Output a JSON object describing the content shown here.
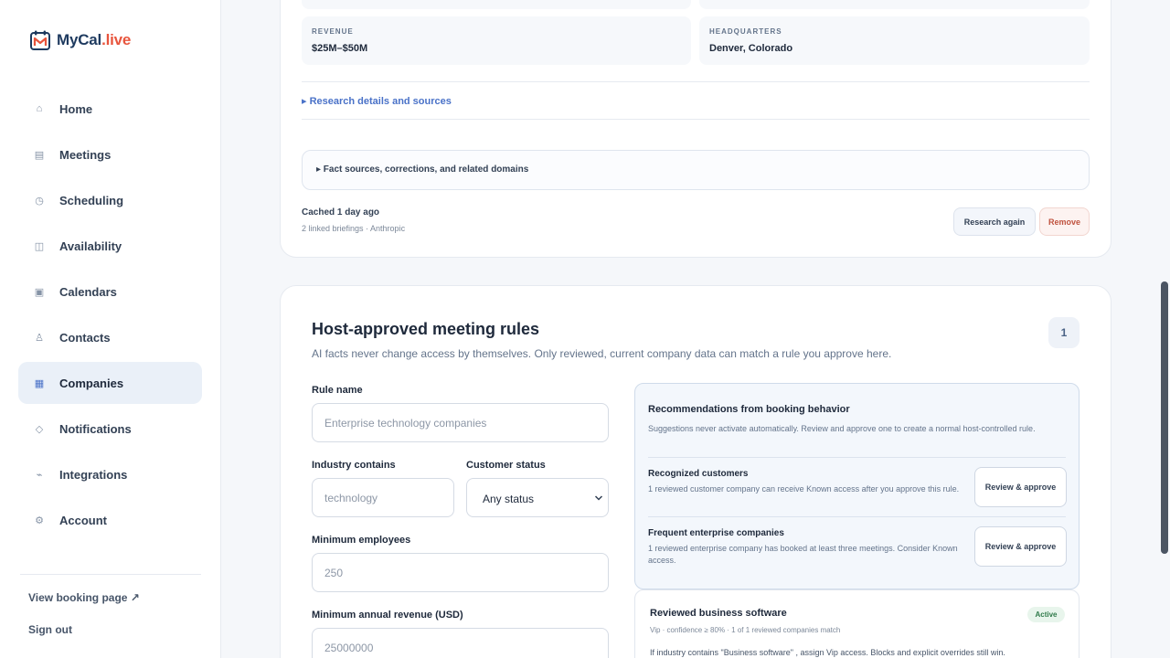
{
  "brand": {
    "name": "MyCal",
    "tld": ".live"
  },
  "sidebar": {
    "items": [
      {
        "label": "Home",
        "icon": "home-icon"
      },
      {
        "label": "Meetings",
        "icon": "list-icon"
      },
      {
        "label": "Scheduling",
        "icon": "clock-icon"
      },
      {
        "label": "Availability",
        "icon": "columns-icon"
      },
      {
        "label": "Calendars",
        "icon": "calendar-square-icon"
      },
      {
        "label": "Contacts",
        "icon": "person-icon"
      },
      {
        "label": "Companies",
        "icon": "grid-icon",
        "active": true
      },
      {
        "label": "Notifications",
        "icon": "diamond-icon"
      },
      {
        "label": "Integrations",
        "icon": "plug-icon"
      },
      {
        "label": "Account",
        "icon": "gear-icon"
      }
    ],
    "view_booking": "View booking page ↗",
    "sign_out": "Sign out"
  },
  "company": {
    "revenue_label": "REVENUE",
    "revenue_value": "$25M–$50M",
    "hq_label": "HEADQUARTERS",
    "hq_value": "Denver, Colorado",
    "research_link": "▸ Research details and sources",
    "fact_sources": "▸ Fact sources, corrections, and related domains",
    "cached": "Cached 1 day ago",
    "cached_sub": "2 linked briefings · Anthropic",
    "research_again": "Research again",
    "remove": "Remove"
  },
  "rules": {
    "title": "Host-approved meeting rules",
    "subtitle": "AI facts never change access by themselves. Only reviewed, current company data can match a rule you approve here.",
    "count": "1",
    "rule_name_label": "Rule name",
    "rule_name_placeholder": "Enterprise technology companies",
    "industry_label": "Industry contains",
    "industry_placeholder": "technology",
    "status_label": "Customer status",
    "status_value": "Any status",
    "min_employees_label": "Minimum employees",
    "min_employees_placeholder": "250",
    "min_revenue_label": "Minimum annual revenue (USD)",
    "min_revenue_placeholder": "25000000"
  },
  "recommendations": {
    "title": "Recommendations from booking behavior",
    "description": "Suggestions never activate automatically. Review and approve one to create a normal host-controlled rule.",
    "items": [
      {
        "title": "Recognized customers",
        "description": "1 reviewed customer company can receive Known access after you approve this rule.",
        "button": "Review & approve"
      },
      {
        "title": "Frequent enterprise companies",
        "description": "1 reviewed enterprise company has booked at least three meetings. Consider Known access.",
        "button": "Review & approve"
      }
    ]
  },
  "active_rule": {
    "title": "Reviewed business software",
    "status": "Active",
    "meta": "Vip · confidence ≥ 80% · 1 of 1 reviewed companies match",
    "description": "If industry contains \"Business software\" , assign Vip access. Blocks and explicit overrides still win."
  },
  "colors": {
    "accent": "#4a72c8",
    "brand": "#1e3a5f",
    "brand_tld": "#e8553d",
    "danger": "#c0533f",
    "success": "#2f7a4a"
  }
}
